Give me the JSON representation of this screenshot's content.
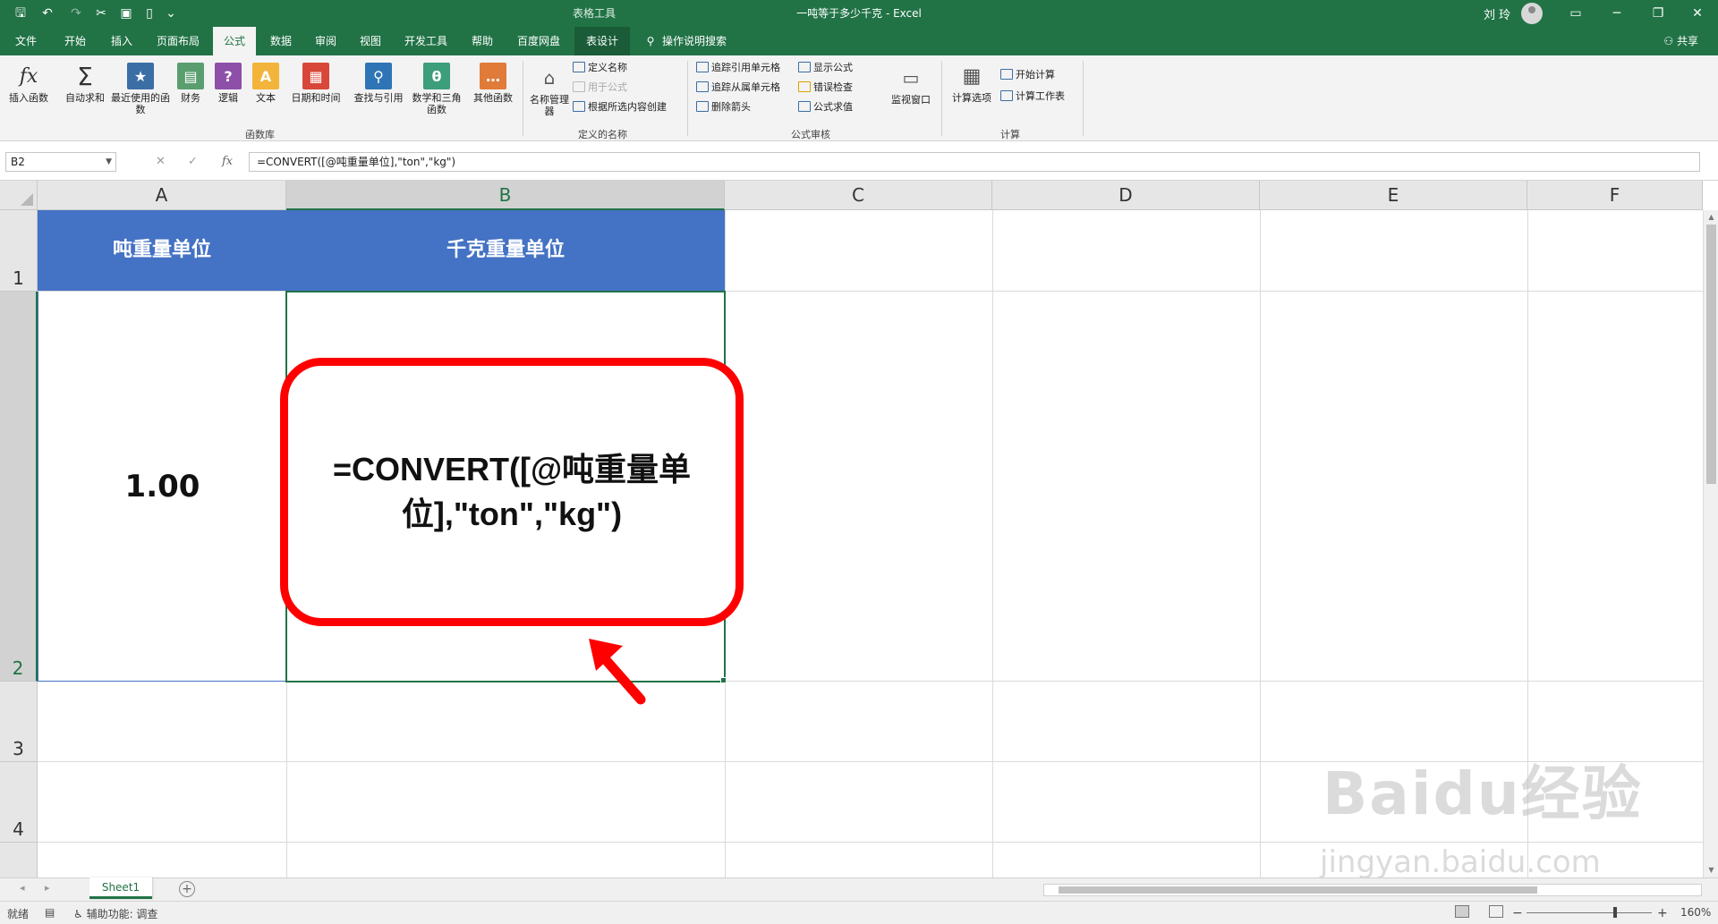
{
  "titlebar": {
    "title": "一吨等于多少千克 - Excel",
    "context_group": "表格工具",
    "user": "刘 玲",
    "minimize": "─",
    "restore": "❐",
    "close": "✕",
    "ribbon_display": "▭"
  },
  "quick_access": {
    "save": "🖫",
    "undo": "↶",
    "redo": "↷",
    "cut": "✂",
    "more": "⌄"
  },
  "tabs": [
    "文件",
    "开始",
    "插入",
    "页面布局",
    "公式",
    "数据",
    "审阅",
    "视图",
    "开发工具",
    "帮助",
    "百度网盘",
    "表设计"
  ],
  "active_tab": "公式",
  "tell_me": "操作说明搜索",
  "share": "共享",
  "ribbon": {
    "insert_function": "插入函数",
    "autosum": "自动求和",
    "recent": "最近使用的函数",
    "financial": "财务",
    "logical": "逻辑",
    "text": "文本",
    "datetime": "日期和时间",
    "lookup": "查找与引用",
    "math": "数学和三角函数",
    "other": "其他函数",
    "group_library": "函数库",
    "name_manager": "名称管理器",
    "define_name": "定义名称",
    "use_in_formula": "用于公式",
    "create_from_selection": "根据所选内容创建",
    "group_names": "定义的名称",
    "trace_precedents": "追踪引用单元格",
    "trace_dependents": "追踪从属单元格",
    "remove_arrows": "删除箭头",
    "show_formulas": "显示公式",
    "error_checking": "错误检查",
    "evaluate_formula": "公式求值",
    "watch_window": "监视窗口",
    "group_auditing": "公式审核",
    "calc_options": "计算选项",
    "calc_now": "开始计算",
    "calc_sheet": "计算工作表",
    "group_calc": "计算"
  },
  "formula_bar": {
    "name_box": "B2",
    "cancel": "✕",
    "enter": "✓",
    "fx": "fx",
    "formula": "=CONVERT([@吨重量单位],\"ton\",\"kg\")"
  },
  "grid": {
    "columns": [
      "A",
      "B",
      "C",
      "D",
      "E",
      "F"
    ],
    "rows": [
      "1",
      "2",
      "3",
      "4"
    ],
    "header_a": "吨重量单位",
    "header_b": "千克重量单位",
    "a2": "1.00",
    "callout_formula": "=CONVERT([@吨重量单位],\"ton\",\"kg\")",
    "header_fill": "#4472c4",
    "callout_color": "#ff0000"
  },
  "watermark": {
    "logo": "Baidu经验",
    "url": "jingyan.baidu.com"
  },
  "sheets": {
    "tabs": [
      "Sheet1"
    ],
    "add": "+",
    "prev": "◂",
    "next": "▸"
  },
  "status": {
    "ready": "就绪",
    "accessibility": "辅助功能: 调查",
    "zoom": "160%",
    "zoom_out": "−",
    "zoom_in": "+"
  },
  "colors": {
    "excel_green": "#217346"
  }
}
